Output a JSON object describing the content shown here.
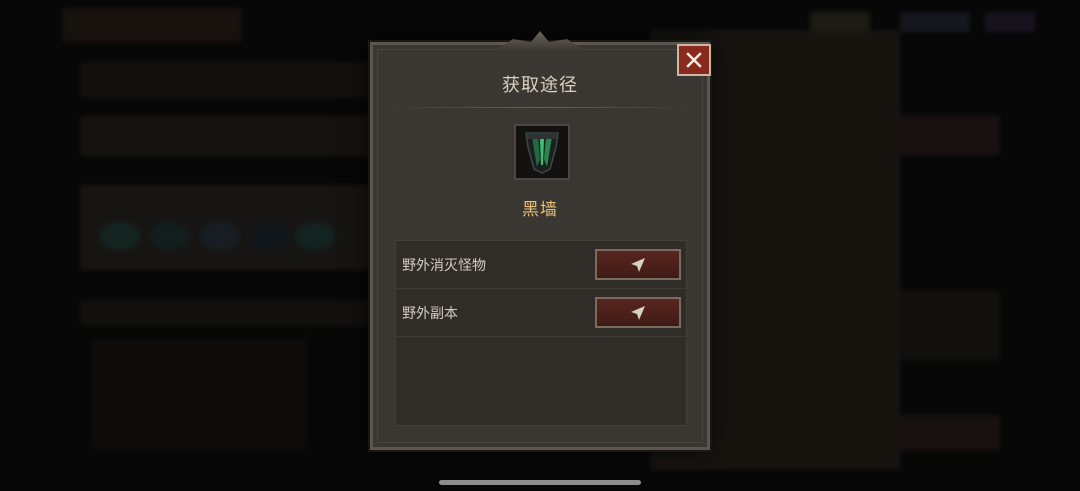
{
  "dialog": {
    "title": "获取途径",
    "item": {
      "name": "黑墙",
      "icon": "black-shield-item-icon"
    },
    "sources": [
      {
        "label": "野外消灭怪物",
        "button_icon": "navigate-arrow-icon"
      },
      {
        "label": "野外副本",
        "button_icon": "navigate-arrow-icon"
      }
    ],
    "close_icon": "close-x-icon"
  },
  "colors": {
    "title": "#d8cfc2",
    "item_name": "#e8c07a",
    "close_button": "#8a2a1e",
    "go_button": "#5a2620"
  }
}
